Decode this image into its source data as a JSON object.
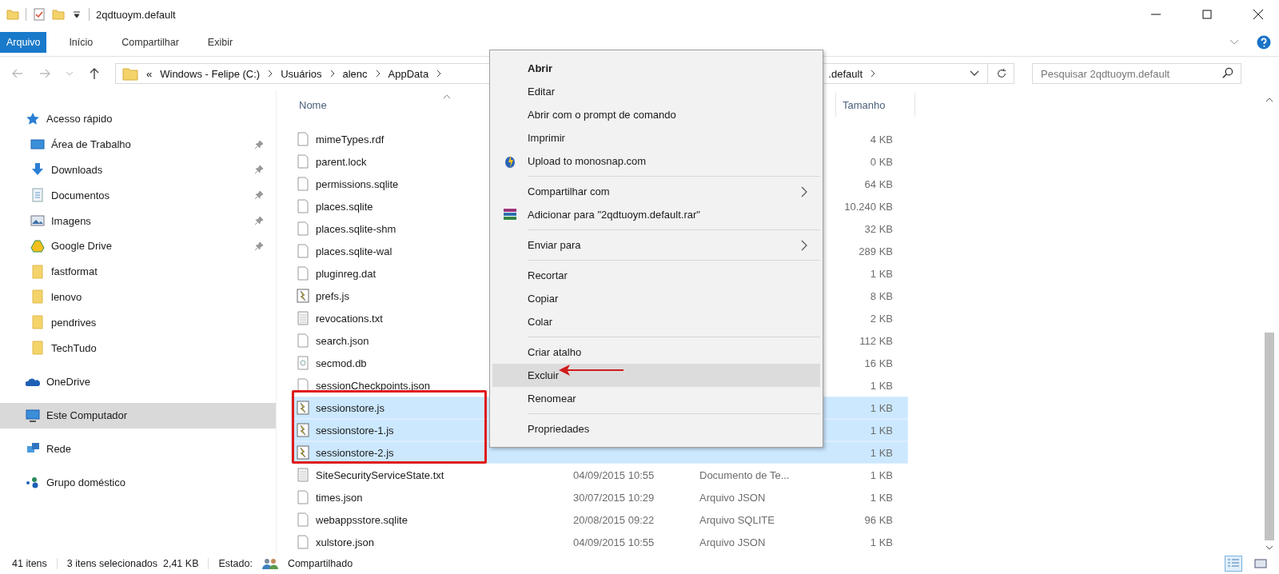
{
  "window": {
    "title": "2qdtuoym.default"
  },
  "ribbon_tabs": [
    {
      "label": "Arquivo",
      "selected": true
    },
    {
      "label": "Início",
      "selected": false
    },
    {
      "label": "Compartilhar",
      "selected": false
    },
    {
      "label": "Exibir",
      "selected": false
    }
  ],
  "address": {
    "overflow": "«",
    "segments": [
      "Windows - Felipe (C:)",
      "Usuários",
      "alenc",
      "AppData"
    ],
    "tail": ".default"
  },
  "search": {
    "placeholder": "Pesquisar 2qdtuoym.default"
  },
  "sidebar": {
    "items": [
      {
        "label": "Acesso rápido",
        "kind": "quick-access",
        "selected": false,
        "children": [
          {
            "label": "Área de Trabalho",
            "kind": "desktop",
            "pinned": true,
            "selected": false
          },
          {
            "label": "Downloads",
            "kind": "downloads",
            "pinned": true,
            "selected": false
          },
          {
            "label": "Documentos",
            "kind": "documents",
            "pinned": true,
            "selected": false
          },
          {
            "label": "Imagens",
            "kind": "pictures",
            "pinned": true,
            "selected": false
          },
          {
            "label": "Google Drive",
            "kind": "cloud-drive",
            "pinned": true,
            "selected": false
          },
          {
            "label": "fastformat",
            "kind": "folder",
            "pinned": false,
            "selected": false
          },
          {
            "label": "lenovo",
            "kind": "folder",
            "pinned": false,
            "selected": false
          },
          {
            "label": "pendrives",
            "kind": "folder",
            "pinned": false,
            "selected": false
          },
          {
            "label": "TechTudo",
            "kind": "folder",
            "pinned": false,
            "selected": false
          }
        ]
      },
      {
        "label": "OneDrive",
        "kind": "onedrive",
        "selected": false
      },
      {
        "label": "Este Computador",
        "kind": "this-pc",
        "selected": true
      },
      {
        "label": "Rede",
        "kind": "network",
        "selected": false
      },
      {
        "label": "Grupo doméstico",
        "kind": "homegroup",
        "selected": false
      }
    ]
  },
  "table": {
    "columns": [
      "Nome",
      "Tamanho"
    ],
    "rows": [
      {
        "name": "mimeTypes.rdf",
        "kind": "file",
        "size": "4 KB",
        "selected": false
      },
      {
        "name": "parent.lock",
        "kind": "file",
        "size": "0 KB",
        "selected": false
      },
      {
        "name": "permissions.sqlite",
        "kind": "file",
        "size": "64 KB",
        "selected": false
      },
      {
        "name": "places.sqlite",
        "kind": "file",
        "size": "10.240 KB",
        "selected": false
      },
      {
        "name": "places.sqlite-shm",
        "kind": "file",
        "size": "32 KB",
        "selected": false
      },
      {
        "name": "places.sqlite-wal",
        "kind": "file",
        "size": "289 KB",
        "selected": false
      },
      {
        "name": "pluginreg.dat",
        "kind": "file",
        "size": "1 KB",
        "selected": false
      },
      {
        "name": "prefs.js",
        "kind": "script",
        "size": "8 KB",
        "selected": false
      },
      {
        "name": "revocations.txt",
        "kind": "text",
        "size": "2 KB",
        "selected": false
      },
      {
        "name": "search.json",
        "kind": "file",
        "size": "112 KB",
        "selected": false
      },
      {
        "name": "secmod.db",
        "kind": "database",
        "size": "16 KB",
        "selected": false
      },
      {
        "name": "sessionCheckpoints.json",
        "kind": "file",
        "size": "1 KB",
        "selected": false
      },
      {
        "name": "sessionstore.js",
        "kind": "script",
        "size": "1 KB",
        "selected": true
      },
      {
        "name": "sessionstore-1.js",
        "kind": "script",
        "size": "1 KB",
        "selected": true
      },
      {
        "name": "sessionstore-2.js",
        "kind": "script",
        "size": "1 KB",
        "selected": true
      },
      {
        "name": "SiteSecurityServiceState.txt",
        "kind": "text",
        "date": "04/09/2015 10:55",
        "type": "Documento de Te...",
        "size": "1 KB",
        "selected": false
      },
      {
        "name": "times.json",
        "kind": "file",
        "date": "30/07/2015 10:29",
        "type": "Arquivo JSON",
        "size": "1 KB",
        "selected": false
      },
      {
        "name": "webappsstore.sqlite",
        "kind": "file",
        "date": "20/08/2015 09:22",
        "type": "Arquivo SQLITE",
        "size": "96 KB",
        "selected": false
      },
      {
        "name": "xulstore.json",
        "kind": "file",
        "date": "04/09/2015 10:55",
        "type": "Arquivo JSON",
        "size": "1 KB",
        "selected": false
      }
    ]
  },
  "context_menu": {
    "items": [
      {
        "kind": "default",
        "label": "Abrir",
        "selected": false
      },
      {
        "kind": "plain",
        "label": "Editar",
        "selected": false
      },
      {
        "kind": "plain",
        "label": "Abrir com o prompt de comando",
        "selected": false
      },
      {
        "kind": "plain",
        "label": "Imprimir",
        "selected": false
      },
      {
        "kind": "upload",
        "label": "Upload to monosnap.com",
        "selected": false
      },
      {
        "kind": "separator"
      },
      {
        "kind": "submenu",
        "label": "Compartilhar com",
        "selected": false
      },
      {
        "kind": "archive",
        "label": "Adicionar para \"2qdtuoym.default.rar\"",
        "selected": false
      },
      {
        "kind": "separator"
      },
      {
        "kind": "submenu",
        "label": "Enviar para",
        "selected": false
      },
      {
        "kind": "separator"
      },
      {
        "kind": "plain",
        "label": "Recortar",
        "selected": false
      },
      {
        "kind": "plain",
        "label": "Copiar",
        "selected": false
      },
      {
        "kind": "plain",
        "label": "Colar",
        "selected": false
      },
      {
        "kind": "separator"
      },
      {
        "kind": "plain",
        "label": "Criar atalho",
        "selected": false
      },
      {
        "kind": "plain",
        "label": "Excluir",
        "selected": true
      },
      {
        "kind": "plain",
        "label": "Renomear",
        "selected": false
      },
      {
        "kind": "separator"
      },
      {
        "kind": "plain",
        "label": "Propriedades",
        "selected": false
      }
    ]
  },
  "status_bar": {
    "count": "41 itens",
    "selection": "3 itens selecionados  2,41 KB",
    "state_label": "Estado:",
    "state": "Compartilhado"
  }
}
